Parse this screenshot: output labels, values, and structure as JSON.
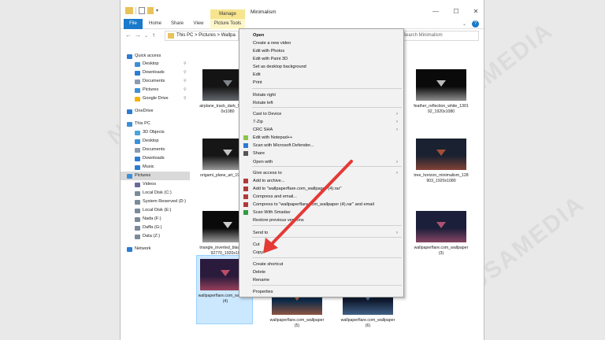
{
  "window": {
    "title": "Minimalism",
    "manage_tab": "Manage",
    "picture_tools_tab": "Picture Tools",
    "ribbon_tabs": [
      "File",
      "Home",
      "Share",
      "View"
    ],
    "controls": {
      "minimize": "—",
      "maximize": "☐",
      "close": "✕"
    },
    "help": "?"
  },
  "address_bar": {
    "path": "This PC  >  Pictures  >  Wallpa",
    "search_placeholder": "Search Minimalism"
  },
  "navigation": {
    "items": [
      {
        "label": "Quick access",
        "icon": "star-icon",
        "color": "#2b7cd3",
        "pinned": false
      },
      {
        "label": "Desktop",
        "icon": "desktop-icon",
        "color": "#3c8fd9",
        "pinned": true
      },
      {
        "label": "Downloads",
        "icon": "download-icon",
        "color": "#2b7cd3",
        "pinned": true
      },
      {
        "label": "Documents",
        "icon": "document-icon",
        "color": "#8a9bb0",
        "pinned": true
      },
      {
        "label": "Pictures",
        "icon": "picture-icon",
        "color": "#3c8fd9",
        "pinned": true
      },
      {
        "label": "Google Drive",
        "icon": "google-drive-icon",
        "color": "#f4b400",
        "pinned": true
      },
      {
        "label": "OneDrive",
        "icon": "cloud-icon",
        "color": "#2b7cd3",
        "pinned": false
      },
      {
        "label": "This PC",
        "icon": "computer-icon",
        "color": "#3c8fd9",
        "pinned": false
      },
      {
        "label": "3D Objects",
        "icon": "cube-icon",
        "color": "#4aa3df",
        "pinned": false
      },
      {
        "label": "Desktop",
        "icon": "desktop-icon",
        "color": "#3c8fd9",
        "pinned": false
      },
      {
        "label": "Documents",
        "icon": "document-icon",
        "color": "#8a9bb0",
        "pinned": false
      },
      {
        "label": "Downloads",
        "icon": "download-icon",
        "color": "#2b7cd3",
        "pinned": false
      },
      {
        "label": "Music",
        "icon": "music-icon",
        "color": "#2b7cd3",
        "pinned": false
      },
      {
        "label": "Pictures",
        "icon": "picture-icon",
        "color": "#3c8fd9",
        "pinned": false,
        "selected": true
      },
      {
        "label": "Videos",
        "icon": "video-icon",
        "color": "#6a6a9a",
        "pinned": false
      },
      {
        "label": "Local Disk (C:)",
        "icon": "drive-icon",
        "color": "#7a8a99",
        "pinned": false
      },
      {
        "label": "System Reserved (D:)",
        "icon": "drive-icon",
        "color": "#7a8a99",
        "pinned": false
      },
      {
        "label": "Local Disk (E:)",
        "icon": "drive-icon",
        "color": "#7a8a99",
        "pinned": false
      },
      {
        "label": "Nada (F:)",
        "icon": "drive-icon",
        "color": "#7a8a99",
        "pinned": false
      },
      {
        "label": "Daffa (G:)",
        "icon": "drive-icon",
        "color": "#7a8a99",
        "pinned": false
      },
      {
        "label": "Data (Z:)",
        "icon": "drive-icon",
        "color": "#7a8a99",
        "pinned": false
      },
      {
        "label": "Network",
        "icon": "network-icon",
        "color": "#2b7cd3",
        "pinned": false
      }
    ]
  },
  "files": [
    {
      "label": "airplane_track_dark_9015_1920x1080",
      "thumb": "#141414",
      "accent": "#9aa0a8"
    },
    {
      "label": "feather_reflection_white_130192_1920x1080",
      "thumb": "#0a0a0a",
      "accent": "#e8e8e8"
    },
    {
      "label": "origami_plane_art_1920x1080",
      "thumb": "#161616",
      "accent": "#f0f0f0"
    },
    {
      "label": "tree_horizon_minimalism_128903_1920x1080",
      "thumb": "#1a2130",
      "accent": "#c75a3a"
    },
    {
      "label": "triangle_inverted_black_white_92770_1920x1080",
      "thumb": "#0a0a0a",
      "accent": "#ffffff"
    },
    {
      "label": "wallpaperflare.com_wallpaper (3)",
      "thumb": "#1c1f3a",
      "accent": "#d06080"
    },
    {
      "label": "wallpaperflare.com_wallpaper (4)",
      "thumb": "#2a1a3c",
      "accent": "#e05a70"
    },
    {
      "label": "wallpaperflare.com_wallpaper (5)",
      "thumb": "#0e2a48",
      "accent": "#e07040"
    },
    {
      "label": "wallpaperflare.com_wallpaper (6)",
      "thumb": "#101a30",
      "accent": "#6090c0"
    }
  ],
  "context_menu": {
    "items": [
      {
        "label": "Open",
        "bold": true
      },
      {
        "label": "Create a new video"
      },
      {
        "label": "Edit with Photos"
      },
      {
        "label": "Edit with Paint 3D"
      },
      {
        "label": "Set as desktop background"
      },
      {
        "label": "Edit"
      },
      {
        "label": "Print"
      },
      {
        "label": "Rotate right"
      },
      {
        "label": "Rotate left"
      },
      {
        "label": "Cast to Device",
        "submenu": true
      },
      {
        "label": "7-Zip",
        "submenu": true
      },
      {
        "label": "CRC SHA",
        "submenu": true
      },
      {
        "label": "Edit with Notepad++",
        "icon": "notepad-plus-icon",
        "color": "#8bc34a"
      },
      {
        "label": "Scan with Microsoft Defender...",
        "icon": "defender-shield-icon",
        "color": "#2b7cd3"
      },
      {
        "label": "Share",
        "icon": "share-icon",
        "color": "#555555"
      },
      {
        "label": "Open with",
        "submenu": true
      },
      {
        "label": "Give access to",
        "submenu": true
      },
      {
        "label": "Add to archive...",
        "icon": "winrar-icon",
        "color": "#b03a3a"
      },
      {
        "label": "Add to \"wallpaperflare.com_wallpaper (4).rar\"",
        "icon": "winrar-icon",
        "color": "#b03a3a"
      },
      {
        "label": "Compress and email...",
        "icon": "winrar-icon",
        "color": "#b03a3a"
      },
      {
        "label": "Compress to \"wallpaperflare.com_wallpaper (4).rar\" and email",
        "icon": "winrar-icon",
        "color": "#b03a3a"
      },
      {
        "label": "Scan With Smadav",
        "icon": "smadav-icon",
        "color": "#2e9e3e"
      },
      {
        "label": "Restore previous versions"
      },
      {
        "label": "Send to",
        "submenu": true
      },
      {
        "label": "Cut"
      },
      {
        "label": "Copy"
      },
      {
        "label": "Create shortcut"
      },
      {
        "label": "Delete"
      },
      {
        "label": "Rename"
      },
      {
        "label": "Properties"
      }
    ]
  },
  "watermark": "NUSAMEDIA",
  "colors": {
    "accent": "#1979ca",
    "arrow": "#e53935",
    "selection": "#cce8ff"
  }
}
